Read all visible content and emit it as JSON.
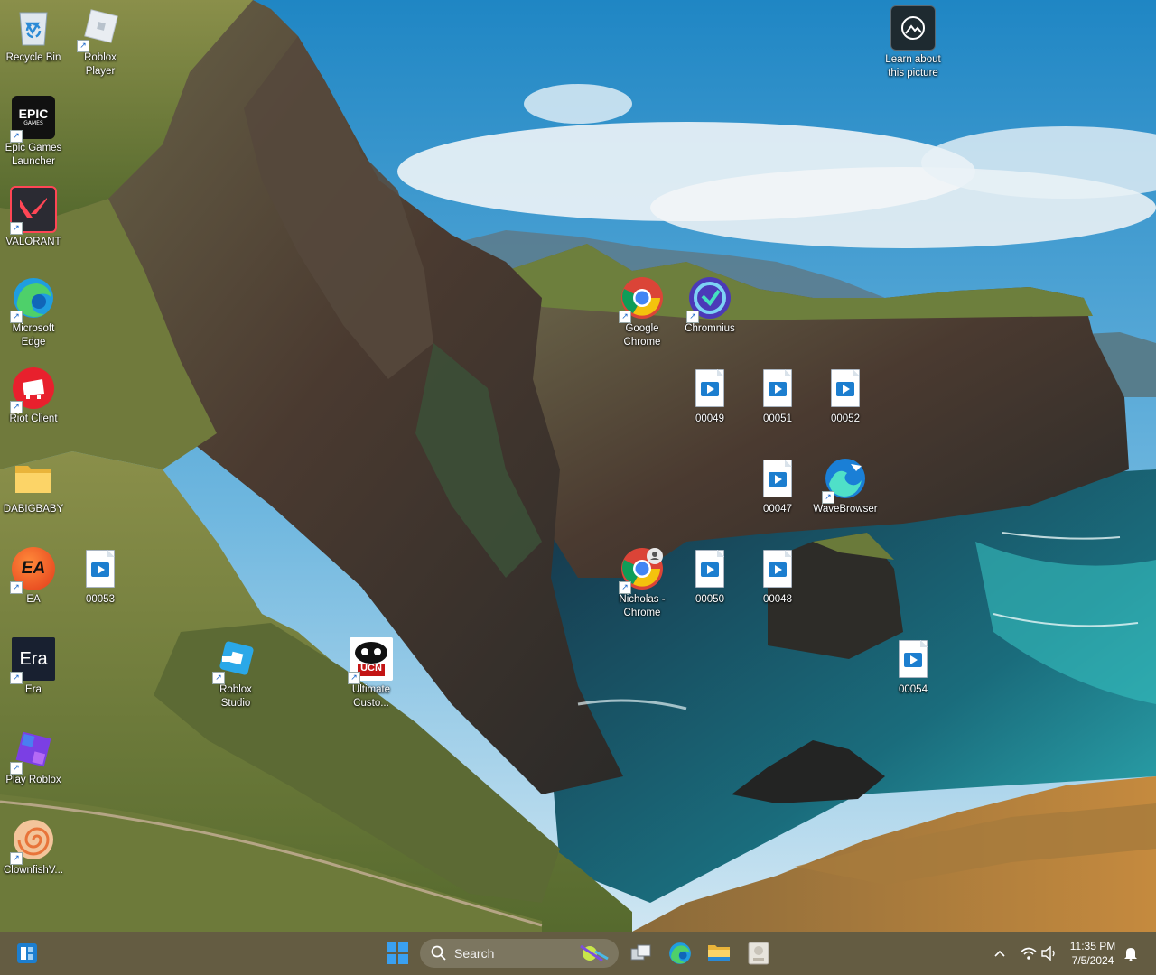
{
  "desktop": {
    "learn_about": "Learn about\nthis picture",
    "icons": {
      "recycle_bin": "Recycle Bin",
      "roblox_player": "Roblox\nPlayer",
      "epic_games": "Epic Games\nLauncher",
      "valorant": "VALORANT",
      "edge": "Microsoft\nEdge",
      "riot": "Riot Client",
      "dabigbaby": "DABIGBABY",
      "ea": "EA",
      "f00053": "00053",
      "era": "Era",
      "roblox_studio": "Roblox\nStudio",
      "ultimate": "Ultimate\nCusto...",
      "play_roblox": "Play Roblox",
      "clownfish": "ClownfishV...",
      "google_chrome": "Google\nChrome",
      "chromnius": "Chromnius",
      "f00049": "00049",
      "f00051": "00051",
      "f00052": "00052",
      "f00047": "00047",
      "wavebrowser": "WaveBrowser",
      "nicholas_chrome": "Nicholas -\nChrome",
      "f00050": "00050",
      "f00048": "00048",
      "f00054": "00054"
    },
    "glyphs": {
      "epic": "EPIC",
      "epic_sub": "GAMES",
      "era": "Era",
      "ea": "EA",
      "ucn": "UCN"
    }
  },
  "taskbar": {
    "search_placeholder": "Search",
    "time": "11:35 PM",
    "date": "7/5/2024"
  },
  "colors": {
    "taskbar": "#58503a",
    "accent": "#1c7ecf"
  }
}
